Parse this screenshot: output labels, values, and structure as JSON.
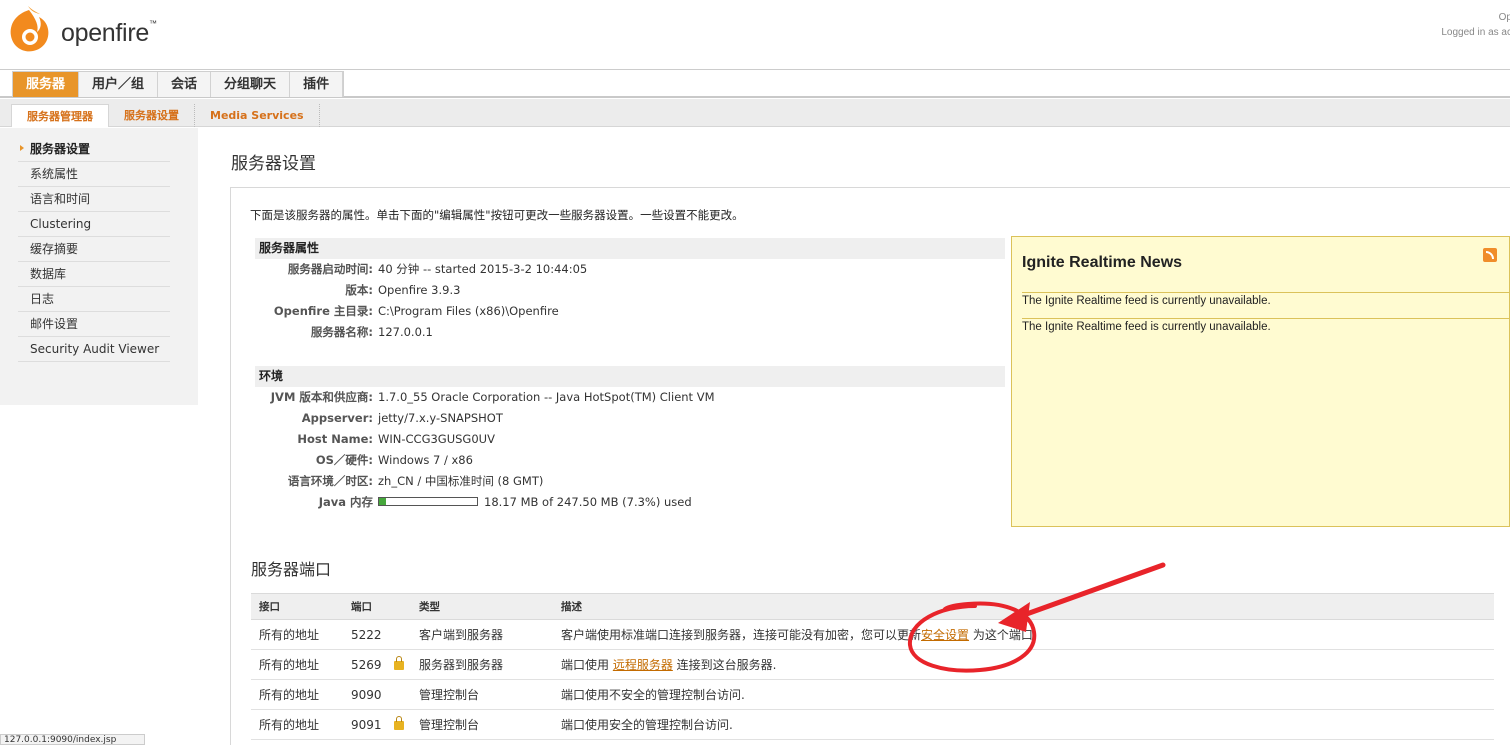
{
  "header": {
    "logo_text": "openfire",
    "logo_mark": "™",
    "user_line1": "Op",
    "user_line2": "Logged in as ac"
  },
  "main_tabs": [
    "服务器",
    "用户／组",
    "会话",
    "分组聊天",
    "插件"
  ],
  "sub_tabs": [
    "服务器管理器",
    "服务器设置",
    "Media Services"
  ],
  "sidebar": {
    "items": [
      "服务器设置",
      "系统属性",
      "语言和时间",
      "Clustering",
      "缓存摘要",
      "数据库",
      "日志",
      "邮件设置",
      "Security Audit Viewer"
    ]
  },
  "page": {
    "title": "服务器设置",
    "intro": "下面是该服务器的属性。单击下面的\"编辑属性\"按钮可更改一些服务器设置。一些设置不能更改。"
  },
  "server_props": {
    "heading": "服务器属性",
    "rows": [
      {
        "label": "服务器启动时间:",
        "value": "40 分钟 -- started 2015-3-2 10:44:05"
      },
      {
        "label": "版本:",
        "value": "Openfire 3.9.3"
      },
      {
        "label": "Openfire 主目录:",
        "value": "C:\\Program Files (x86)\\Openfire"
      },
      {
        "label": "服务器名称:",
        "value": "127.0.0.1"
      }
    ]
  },
  "environment": {
    "heading": "环境",
    "rows": [
      {
        "label": "JVM 版本和供应商:",
        "value": "1.7.0_55 Oracle Corporation -- Java HotSpot(TM) Client VM"
      },
      {
        "label": "Appserver:",
        "value": "jetty/7.x.y-SNAPSHOT"
      },
      {
        "label": "Host Name:",
        "value": "WIN-CCG3GUSG0UV"
      },
      {
        "label": "OS／硬件:",
        "value": "Windows 7 / x86"
      },
      {
        "label": "语言环境／时区:",
        "value": "zh_CN / 中国标准时间 (8 GMT)"
      }
    ],
    "memory_label": "Java 内存",
    "memory_text": "18.17 MB of 247.50 MB (7.3%) used",
    "memory_fraction": 0.073
  },
  "news": {
    "title": "Ignite Realtime News",
    "items": [
      "The Ignite Realtime feed is currently unavailable.",
      "The Ignite Realtime feed is currently unavailable."
    ],
    "icon": "rss-icon"
  },
  "ports": {
    "title": "服务器端口",
    "headers": [
      "接口",
      "端口",
      "类型",
      "描述"
    ],
    "rows": [
      {
        "iface": "所有的地址",
        "port": "5222",
        "type": "客户端到服务器",
        "desc_pre": "客户端使用标准端口连接到服务器，连接可能没有加密，您可以更新",
        "desc_link": "安全设置",
        "desc_post": " 为这个端口"
      },
      {
        "iface": "所有的地址",
        "port": "5269",
        "type": "服务器到服务器",
        "desc_pre": "端口使用 ",
        "desc_link": "远程服务器",
        "desc_post": " 连接到这台服务器."
      },
      {
        "iface": "所有的地址",
        "port": "9090",
        "type": "管理控制台",
        "desc_pre": "端口使用不安全的管理控制台访问.",
        "desc_link": "",
        "desc_post": ""
      },
      {
        "iface": "所有的地址",
        "port": "9091",
        "type": "管理控制台",
        "desc_pre": "端口使用安全的管理控制台访问.",
        "desc_link": "",
        "desc_post": ""
      }
    ]
  },
  "status_bar": "127.0.0.1:9090/index.jsp",
  "colors": {
    "accent": "#e8952a",
    "link": "#c36b00",
    "annotation": "#e8242a",
    "news_bg": "#fffbd1"
  }
}
